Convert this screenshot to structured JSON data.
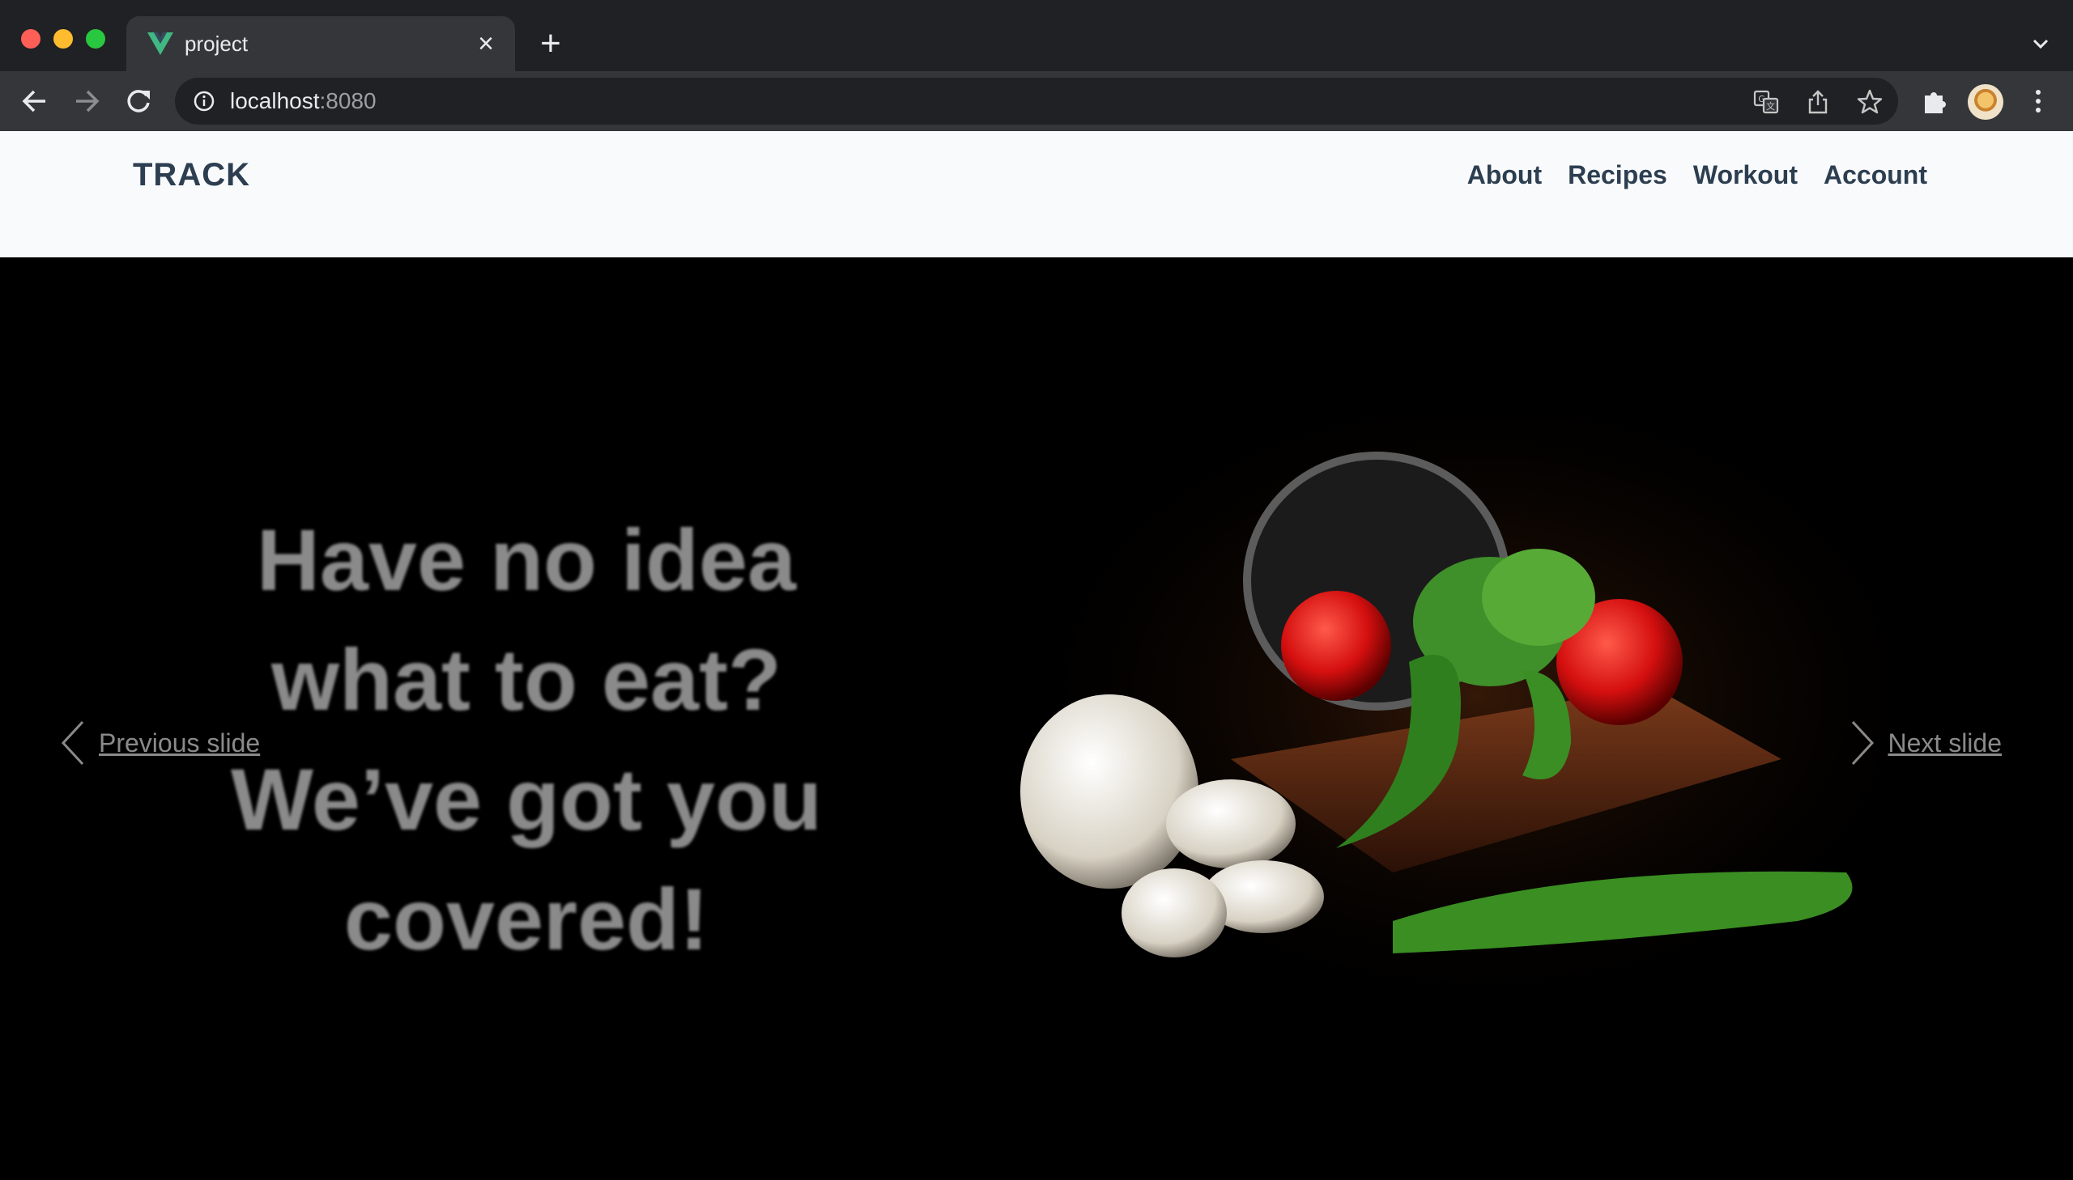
{
  "browser": {
    "tab_title": "project",
    "url_host": "localhost",
    "url_port": ":8080"
  },
  "site": {
    "logo": "TRACK",
    "nav": [
      "About",
      "Recipes",
      "Workout",
      "Account"
    ]
  },
  "hero": {
    "lines": [
      "Have no idea",
      "what to eat?",
      "We’ve got you",
      "covered!"
    ],
    "prev_label": "Previous slide",
    "next_label": "Next slide"
  }
}
